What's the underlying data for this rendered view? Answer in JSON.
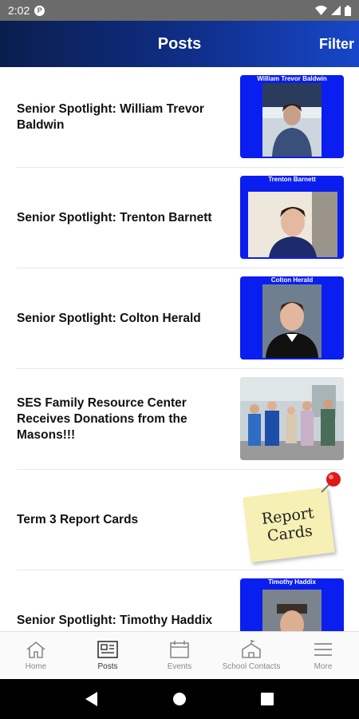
{
  "status": {
    "time": "2:02"
  },
  "header": {
    "title": "Posts",
    "filter_label": "Filter"
  },
  "posts": [
    {
      "title": "Senior Spotlight: William Trevor Baldwin",
      "thumb_caption": "William Trevor Baldwin"
    },
    {
      "title": "Senior Spotlight: Trenton Barnett",
      "thumb_caption": "Trenton Barnett"
    },
    {
      "title": "Senior Spotlight: Colton Herald",
      "thumb_caption": "Colton Herald"
    },
    {
      "title": "SES Family Resource Center Receives Donations from the Masons!!!"
    },
    {
      "title": "Term 3 Report Cards",
      "note_text": "Report Cards"
    },
    {
      "title": "Senior Spotlight: Timothy Haddix",
      "thumb_caption": "Timothy Haddix"
    }
  ],
  "nav": [
    {
      "label": "Home",
      "icon": "home-icon"
    },
    {
      "label": "Posts",
      "icon": "posts-icon",
      "active": true
    },
    {
      "label": "Events",
      "icon": "calendar-icon"
    },
    {
      "label": "School Contacts",
      "icon": "school-icon"
    },
    {
      "label": "More",
      "icon": "menu-icon"
    }
  ],
  "colors": {
    "header_start": "#0a1e4d",
    "header_end": "#1747c9",
    "thumb_blue": "#0b1ef0",
    "status_bar": "#6b6b6b"
  }
}
